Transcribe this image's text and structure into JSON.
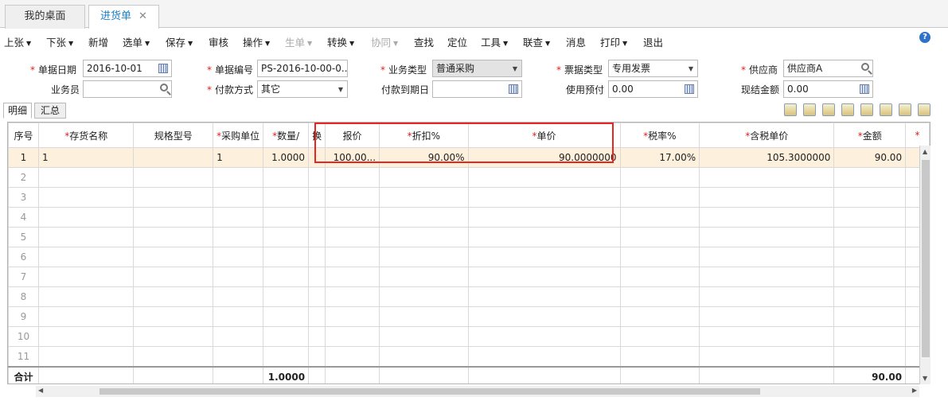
{
  "tabs": [
    {
      "label": "我的桌面"
    },
    {
      "label": "进货单",
      "close": "✕"
    }
  ],
  "toolbar": [
    {
      "label": "上张",
      "dropdown": true
    },
    {
      "label": "下张",
      "dropdown": true
    },
    {
      "label": "新增",
      "dropdown": false
    },
    {
      "label": "选单",
      "dropdown": true
    },
    {
      "label": "保存",
      "dropdown": true
    },
    {
      "label": "审核",
      "dropdown": false
    },
    {
      "label": "操作",
      "dropdown": true
    },
    {
      "label": "生单",
      "dropdown": true,
      "disabled": true
    },
    {
      "label": "转换",
      "dropdown": true
    },
    {
      "label": "协同",
      "dropdown": true,
      "disabled": true
    },
    {
      "label": "查找",
      "dropdown": false
    },
    {
      "label": "定位",
      "dropdown": false
    },
    {
      "label": "工具",
      "dropdown": true
    },
    {
      "label": "联查",
      "dropdown": true
    },
    {
      "label": "消息",
      "dropdown": false
    },
    {
      "label": "打印",
      "dropdown": true
    },
    {
      "label": "退出",
      "dropdown": false
    }
  ],
  "form": {
    "doc_date": {
      "label": "单据日期",
      "value": "2016-10-01"
    },
    "doc_no": {
      "label": "单据编号",
      "value": "PS-2016-10-00-0..."
    },
    "biz_type": {
      "label": "业务类型",
      "value": "普通采购"
    },
    "invoice_type": {
      "label": "票据类型",
      "value": "专用发票"
    },
    "supplier": {
      "label": "供应商",
      "value": "供应商A"
    },
    "salesman": {
      "label": "业务员",
      "value": ""
    },
    "pay_method": {
      "label": "付款方式",
      "value": "其它"
    },
    "due_date": {
      "label": "付款到期日",
      "value": ""
    },
    "prepaid": {
      "label": "使用预付",
      "value": "0.00"
    },
    "cash_amount": {
      "label": "现结金额",
      "value": "0.00"
    }
  },
  "subtabs": [
    "明细",
    "汇总"
  ],
  "table": {
    "columns": [
      "序号",
      "存货名称",
      "规格型号",
      "采购单位",
      "数量/",
      "换",
      "报价",
      "折扣%",
      "单价",
      "税率%",
      "含税单价",
      "金额",
      ""
    ],
    "required": [
      false,
      true,
      false,
      true,
      true,
      false,
      false,
      true,
      true,
      true,
      true,
      true,
      true
    ],
    "rows": [
      [
        "1",
        "1",
        "",
        "1",
        "1.0000",
        "",
        "100.00...",
        "90.00%",
        "90.0000000",
        "17.00%",
        "105.3000000",
        "90.00",
        ""
      ]
    ],
    "empty_rows": [
      "2",
      "3",
      "4",
      "5",
      "6",
      "7",
      "8",
      "9",
      "10",
      "11"
    ],
    "total_label": "合计",
    "total_qty": "1.0000",
    "total_amount": "90.00"
  },
  "help_icon": "?"
}
